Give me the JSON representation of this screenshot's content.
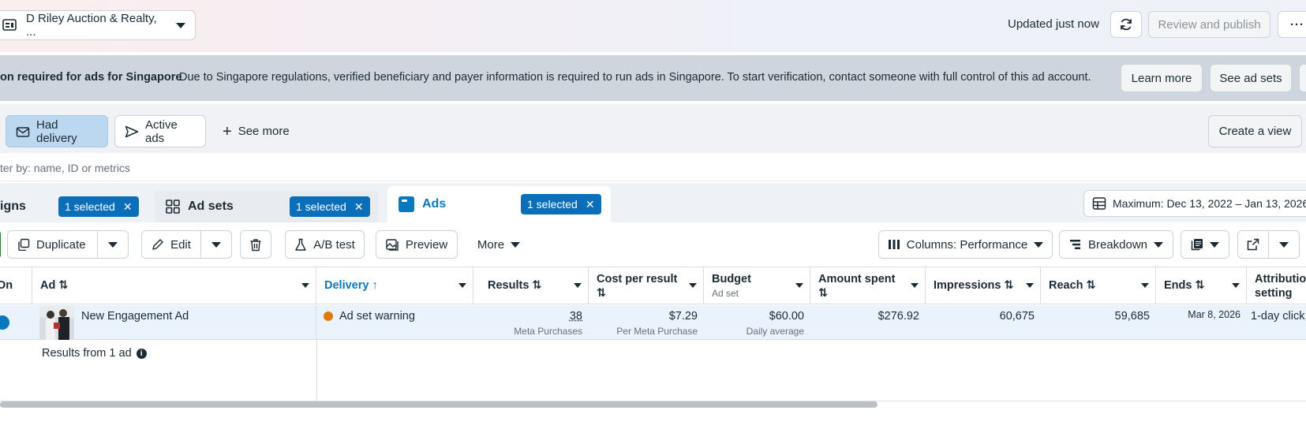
{
  "top": {
    "account_name": "D Riley Auction & Realty, ...",
    "updated_text": "Updated just now",
    "review_label": "Review and publish",
    "more_glyph": "···"
  },
  "banner": {
    "title": "on required for ads for Singapore",
    "text": "Due to Singapore regulations, verified beneficiary and payer information is required to run ads in Singapore. To start verification, contact someone with full control of this ad account.",
    "learn_more": "Learn more",
    "see_ad_sets": "See ad sets"
  },
  "views": {
    "had_delivery": "Had delivery",
    "active_ads": "Active ads",
    "see_more": "See more",
    "create_view": "Create a view"
  },
  "filter": {
    "placeholder": "ter by: name, ID or metrics"
  },
  "tabs": {
    "campaigns": "igns",
    "ad_sets": "Ad sets",
    "ads": "Ads",
    "selected": "1 selected",
    "close": "✕"
  },
  "date_range": "Maximum: Dec 13, 2022 – Jan 13, 2026",
  "toolbar": {
    "duplicate": "Duplicate",
    "edit": "Edit",
    "ab_test": "A/B test",
    "preview": "Preview",
    "more": "More",
    "columns": "Columns: Performance",
    "breakdown": "Breakdown"
  },
  "table": {
    "headers": {
      "on": "On",
      "ad": "Ad ⇅",
      "delivery": "Delivery ↑",
      "results": "Results ⇅",
      "cost_per_result": "Cost per result",
      "cost_sort": "⇅",
      "budget": "Budget",
      "budget_sub": "Ad set",
      "amount_spent": "Amount spent",
      "amount_sort": "⇅",
      "impressions": "Impressions ⇅",
      "reach": "Reach ⇅",
      "ends": "Ends ⇅",
      "attribution": "Attribution",
      "attribution_2": "setting"
    },
    "row": {
      "ad_name": "New Engagement Ad",
      "delivery": "Ad set warning",
      "results": "38",
      "results_sub": "Meta Purchases",
      "cost": "$7.29",
      "cost_sub": "Per Meta Purchase",
      "budget": "$60.00",
      "budget_sub": "Daily average",
      "amount": "$276.92",
      "impressions": "60,675",
      "reach": "59,685",
      "ends": "Mar 8, 2026",
      "attribution": "1-day click"
    },
    "summary": "Results from 1 ad",
    "info_glyph": "i"
  },
  "colors": {
    "accent": "#0a78be",
    "chip": "#0a6fb8",
    "warning": "#e07b00",
    "toggle": "#0a78be"
  }
}
